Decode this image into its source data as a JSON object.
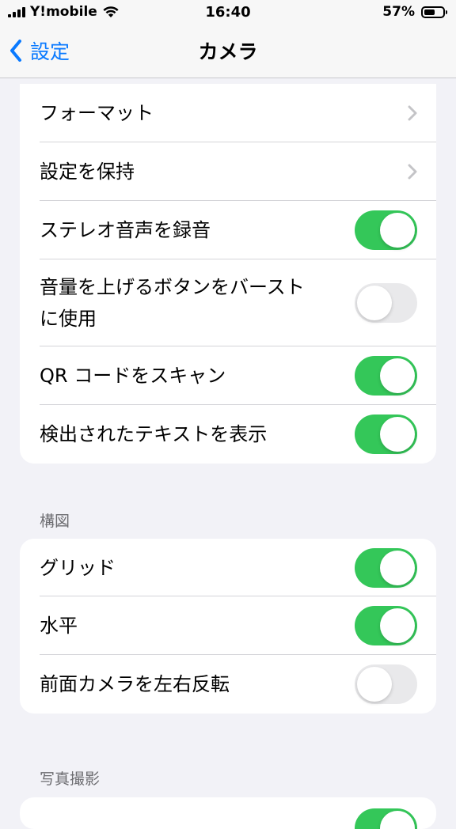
{
  "status_bar": {
    "carrier": "Y!mobile",
    "time": "16:40",
    "battery_percent_text": "57%",
    "battery_level": 0.57
  },
  "nav": {
    "back_label": "設定",
    "title": "カメラ"
  },
  "group1": {
    "rows": [
      {
        "label": "フォーマット",
        "type": "disclosure"
      },
      {
        "label": "設定を保持",
        "type": "disclosure"
      },
      {
        "label": "ステレオ音声を録音",
        "type": "toggle",
        "on": true
      },
      {
        "label": "音量を上げるボタンをバースト\nに使用",
        "type": "toggle",
        "on": false
      },
      {
        "label": "QR コードをスキャン",
        "type": "toggle",
        "on": true
      },
      {
        "label": "検出されたテキストを表示",
        "type": "toggle",
        "on": true
      }
    ]
  },
  "section_composition": {
    "header": "構図",
    "rows": [
      {
        "label": "グリッド",
        "type": "toggle",
        "on": true
      },
      {
        "label": "水平",
        "type": "toggle",
        "on": true
      },
      {
        "label": "前面カメラを左右反転",
        "type": "toggle",
        "on": false
      }
    ]
  },
  "section_photo": {
    "header": "写真撮影"
  },
  "colors": {
    "accent": "#0a7aff",
    "toggle_on": "#34c759",
    "toggle_off": "#e9e9eb",
    "background": "#f2f2f7"
  }
}
